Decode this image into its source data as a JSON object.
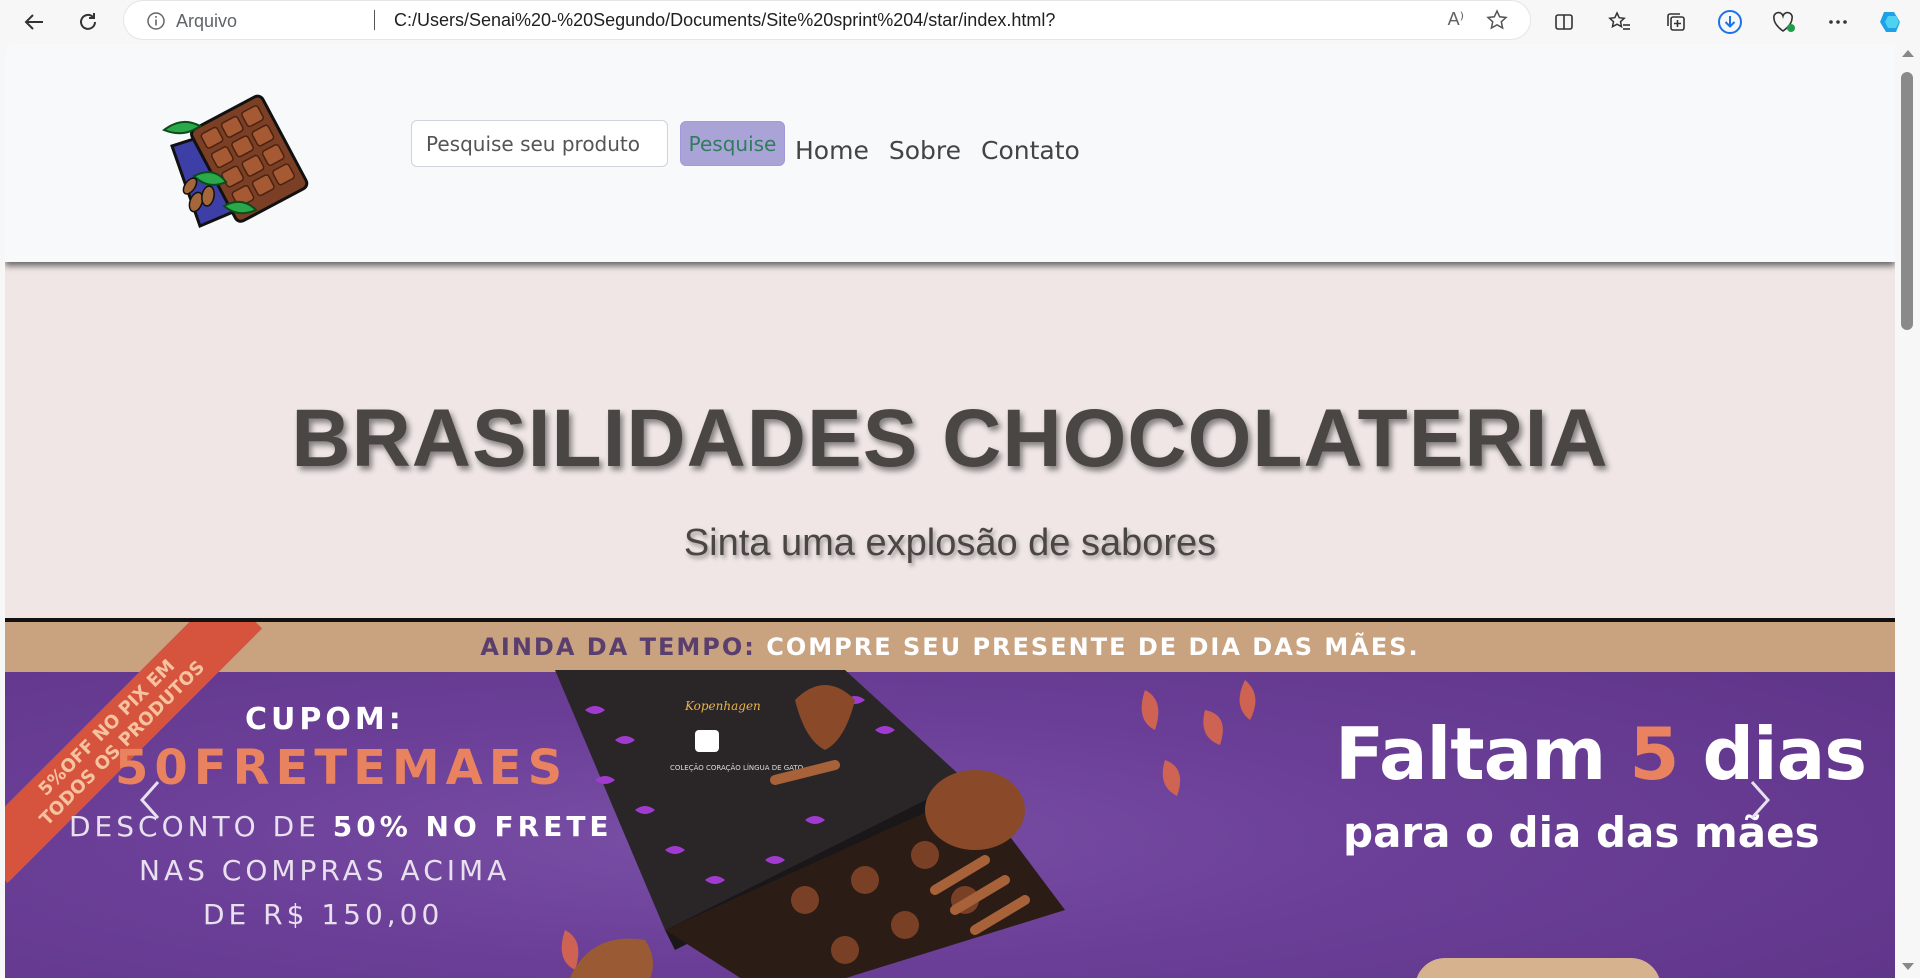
{
  "browser": {
    "protocol_label": "Arquivo",
    "url": "C:/Users/Senai%20-%20Segundo/Documents/Site%20sprint%204/star/index.html?",
    "read_aloud_icon": "A⁾"
  },
  "navbar": {
    "search_placeholder": "Pesquise seu produto",
    "search_button": "Pesquise",
    "links": [
      "Home",
      "Sobre",
      "Contato"
    ]
  },
  "hero": {
    "title": "BRASILIDADES CHOCOLATERIA",
    "subtitle": "Sinta uma explosão de sabores"
  },
  "banner": {
    "top_dark": "AINDA DA TEMPO:",
    "top_light": "COMPRE SEU PRESENTE DE DIA DAS MÃES.",
    "ribbon_line1": "5%OFF NO PIX EM",
    "ribbon_line2": "TODOS OS PRODUTOS",
    "cupom_label": "CUPOM:",
    "cupom_code": "50FRETEMAES",
    "line1_pre": "DESCONTO DE ",
    "line1_bold": "50% NO FRETE",
    "line2": "NAS COMPRAS ACIMA",
    "line3": "DE R$ 150,00",
    "faltam_pre": "Faltam ",
    "faltam_num": "5",
    "faltam_post": " dias",
    "para": "para o dia das mães",
    "box_brand": "Kopenhagen",
    "box_caption": "COLEÇÃO CORAÇÃO LÍNGUA DE GATO"
  },
  "colors": {
    "navbar_bg": "#f8f9fa",
    "hero_bg": "#efe6e5",
    "search_btn_bg": "#a9a3d8",
    "banner_purple": "#6b3f97",
    "banner_strip": "#c9a27f",
    "accent_orange": "#e9825f"
  }
}
